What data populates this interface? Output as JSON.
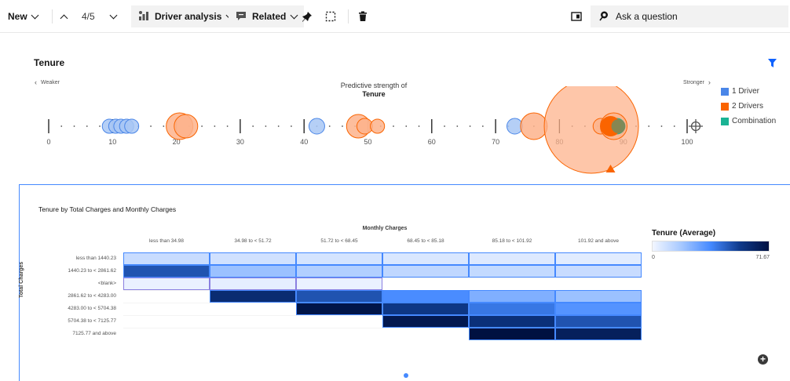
{
  "toolbar": {
    "new_label": "New",
    "page_indicator": "4/5",
    "driver_analysis_label": "Driver analysis",
    "related_label": "Related",
    "ask_placeholder": "Ask a question"
  },
  "drivers": {
    "title": "Tenure",
    "weaker_label": "Weaker",
    "stronger_label": "Stronger",
    "predictive_label": "Predictive strength of",
    "predictive_target": "Tenure",
    "axis_ticks": [
      "0",
      "10",
      "20",
      "30",
      "40",
      "50",
      "60",
      "70",
      "80",
      "90",
      "100"
    ],
    "axis_range": [
      0,
      100
    ],
    "legend": [
      {
        "label": "1 Driver",
        "color": "#4a86e8"
      },
      {
        "label": "2 Drivers",
        "color": "#fa6400"
      },
      {
        "label": "Combination",
        "color": "#1ab394"
      }
    ],
    "bubbles": [
      {
        "x": 9.5,
        "type": "1 Driver"
      },
      {
        "x": 10.5,
        "type": "1 Driver"
      },
      {
        "x": 11.3,
        "type": "1 Driver"
      },
      {
        "x": 12.2,
        "type": "1 Driver"
      },
      {
        "x": 13,
        "type": "1 Driver"
      },
      {
        "x": 20.5,
        "type": "2 Drivers"
      },
      {
        "x": 21.5,
        "type": "2 Drivers"
      },
      {
        "x": 42,
        "type": "1 Driver"
      },
      {
        "x": 48.5,
        "type": "2 Drivers"
      },
      {
        "x": 49.5,
        "type": "2 Drivers"
      },
      {
        "x": 51.5,
        "type": "2 Drivers"
      },
      {
        "x": 73,
        "type": "1 Driver"
      },
      {
        "x": 76,
        "type": "2 Drivers"
      },
      {
        "x": 85,
        "type": "2 Drivers"
      },
      {
        "x": 86.5,
        "type": "2 Drivers"
      },
      {
        "x": 88.5,
        "type": "2 Drivers"
      },
      {
        "x": 89,
        "type": "Combination"
      }
    ],
    "selected_x": 88.5
  },
  "heatmap": {
    "title": "Tenure by Total Charges and Monthly Charges",
    "x_title": "Monthly Charges",
    "y_title": "Total Charges",
    "columns": [
      "less than 34.98",
      "34.98 to < 51.72",
      "51.72 to < 68.45",
      "68.45 to < 85.18",
      "85.18 to < 101.92",
      "101.92 and above"
    ],
    "rows": [
      "less than 1440.23",
      "1440.23 to < 2861.62",
      "<blank>",
      "2861.62 to < 4283.00",
      "4283.00 to < 5704.38",
      "5704.38 to < 7125.77",
      "7125.77 and above"
    ],
    "legend_title": "Tenure (Average)",
    "legend_min": "0",
    "legend_max": "71.67"
  },
  "chart_data": {
    "type": "heatmap",
    "title": "Tenure by Total Charges and Monthly Charges",
    "xlabel": "Monthly Charges",
    "ylabel": "Total Charges",
    "value_label": "Tenure (Average)",
    "range": [
      0,
      71.67
    ],
    "x": [
      "less than 34.98",
      "34.98 to < 51.72",
      "51.72 to < 68.45",
      "68.45 to < 85.18",
      "85.18 to < 101.92",
      "101.92 and above"
    ],
    "y": [
      "less than 1440.23",
      "1440.23 to < 2861.62",
      "<blank>",
      "2861.62 to < 4283.00",
      "4283.00 to < 5704.38",
      "5704.38 to < 7125.77",
      "7125.77 and above"
    ],
    "values": [
      [
        10,
        8,
        7,
        6,
        5,
        4
      ],
      [
        48,
        20,
        15,
        12,
        11,
        10
      ],
      [
        2,
        3,
        2,
        null,
        null,
        null
      ],
      [
        null,
        60,
        48,
        35,
        25,
        20
      ],
      [
        null,
        null,
        70,
        55,
        40,
        33
      ],
      [
        null,
        null,
        null,
        68,
        58,
        48
      ],
      [
        null,
        null,
        null,
        null,
        71.67,
        65
      ]
    ]
  }
}
